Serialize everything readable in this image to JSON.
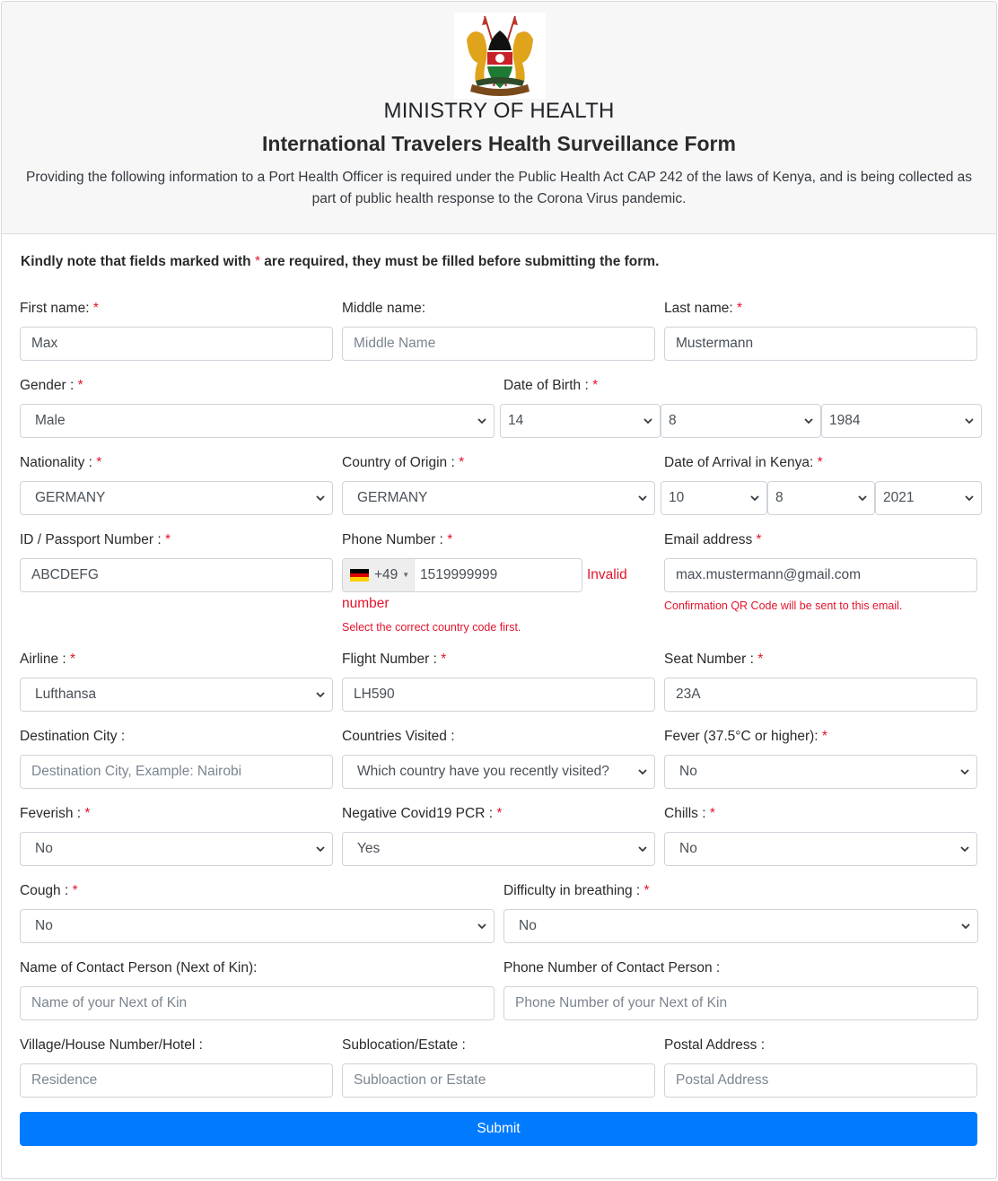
{
  "header": {
    "logo_alt": "Kenya Coat of Arms",
    "ministry": "MINISTRY OF HEALTH",
    "form_title": "International Travelers Health Surveillance Form",
    "intro": "Providing the following information to a Port Health Officer is required under the Public Health Act CAP 242 of the laws of Kenya, and is being collected as part of public health response to the Corona Virus pandemic."
  },
  "note": {
    "before": "Kindly note that fields marked with ",
    "asterisk": "*",
    "after": " are required, they must be filled before submitting the form."
  },
  "colors": {
    "accent": "#007bff",
    "required": "#e3142c",
    "header_bg": "#f7f7f7"
  },
  "fields": {
    "first_name": {
      "label": "First name:",
      "required": "*",
      "value": "Max"
    },
    "middle_name": {
      "label": "Middle name:",
      "placeholder": "Middle Name"
    },
    "last_name": {
      "label": "Last name:",
      "required": "*",
      "value": "Mustermann"
    },
    "gender": {
      "label": "Gender :",
      "required": "*",
      "value": "Male"
    },
    "dob": {
      "label": "Date of Birth :",
      "required": "*",
      "day": "14",
      "month": "8",
      "year": "1984"
    },
    "nationality": {
      "label": "Nationality :",
      "required": "*",
      "value": "GERMANY"
    },
    "country_origin": {
      "label": "Country of Origin :",
      "required": "*",
      "value": "GERMANY"
    },
    "arrival": {
      "label": "Date of Arrival in Kenya:",
      "required": "*",
      "day": "10",
      "month": "8",
      "year": "2021"
    },
    "passport": {
      "label": "ID / Passport Number :",
      "required": "*",
      "value": "ABCDEFG"
    },
    "phone": {
      "label": "Phone Number :",
      "required": "*",
      "country_code": "+49",
      "value": "1519999999",
      "error_inline": "Invalid",
      "error_wrap": "number",
      "hint": "Select the correct country code first."
    },
    "email": {
      "label": "Email address",
      "required": "*",
      "value": "max.mustermann@gmail.com",
      "hint": "Confirmation QR Code will be sent to this email."
    },
    "airline": {
      "label": "Airline :",
      "required": "*",
      "value": "Lufthansa"
    },
    "flight": {
      "label": "Flight Number :",
      "required": "*",
      "value": "LH590"
    },
    "seat": {
      "label": "Seat Number :",
      "required": "*",
      "value": "23A"
    },
    "destination": {
      "label": "Destination City :",
      "placeholder": "Destination City, Example: Nairobi"
    },
    "countries_visited": {
      "label": "Countries Visited :",
      "value": "Which country have you recently visited?"
    },
    "fever": {
      "label": "Fever (37.5°C or higher):",
      "required": "*",
      "value": "No"
    },
    "feverish": {
      "label": "Feverish :",
      "required": "*",
      "value": "No"
    },
    "pcr": {
      "label": "Negative Covid19 PCR :",
      "required": "*",
      "value": "Yes"
    },
    "chills": {
      "label": "Chills :",
      "required": "*",
      "value": "No"
    },
    "cough": {
      "label": "Cough :",
      "required": "*",
      "value": "No"
    },
    "breathing": {
      "label": "Difficulty in breathing :",
      "required": "*",
      "value": "No"
    },
    "kin_name": {
      "label": "Name of Contact Person (Next of Kin):",
      "placeholder": "Name of your Next of Kin"
    },
    "kin_phone": {
      "label": "Phone Number of Contact Person :",
      "placeholder": "Phone Number of your Next of Kin"
    },
    "residence": {
      "label": "Village/House Number/Hotel :",
      "placeholder": "Residence"
    },
    "sublocation": {
      "label": "Sublocation/Estate :",
      "placeholder": "Subloaction or Estate"
    },
    "postal": {
      "label": "Postal Address :",
      "placeholder": "Postal Address"
    }
  },
  "submit_label": "Submit"
}
